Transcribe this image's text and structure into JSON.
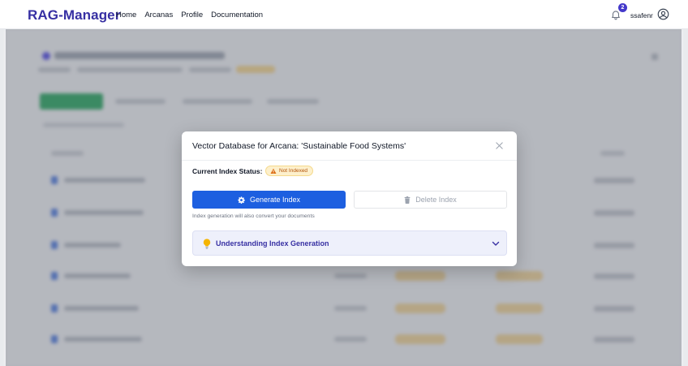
{
  "nav": {
    "brand": "RAG-Manager",
    "links": [
      "Home",
      "Arcanas",
      "Profile",
      "Documentation"
    ],
    "notification_count": "2",
    "username": "ssafenr"
  },
  "modal": {
    "title": "Vector Database for Arcana: 'Sustainable Food Systems'",
    "status_label": "Current Index Status:",
    "status_value": "Not Indexed",
    "generate_label": "Generate Index",
    "delete_label": "Delete Index",
    "hint": "Index generation will also convert your documents",
    "accordion_label": "Understanding Index Generation"
  },
  "icons": {
    "bell": "bell-icon",
    "user": "user-circle-icon",
    "close": "close-icon",
    "warning": "warning-icon",
    "generate": "gear-icon",
    "delete": "trash-icon",
    "bulb": "lightbulb-icon",
    "chevron": "chevron-down-icon"
  },
  "colors": {
    "brand": "#3730a3",
    "primary": "#1d5fe0",
    "warning_bg": "#fdf0cc",
    "warning_text": "#b45309",
    "accordion_bg": "#eef0fb"
  }
}
